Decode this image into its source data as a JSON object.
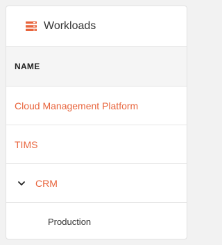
{
  "header": {
    "title": "Workloads",
    "icon": "server-stack-icon",
    "accent": "#e8643c"
  },
  "table": {
    "column_name": "NAME",
    "rows": [
      {
        "label": "Cloud Management Platform"
      },
      {
        "label": "TIMS"
      },
      {
        "label": "CRM",
        "expanded": true,
        "icon": "chevron-down-icon"
      },
      {
        "label": "Production"
      }
    ]
  }
}
